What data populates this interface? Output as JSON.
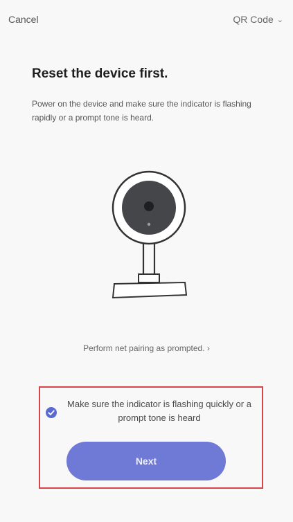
{
  "header": {
    "cancel_label": "Cancel",
    "mode_label": "QR Code",
    "mode_icon": "chevron-down-icon"
  },
  "main": {
    "title": "Reset the device first.",
    "description": "Power on the device and make sure the indicator is flashing rapidly or a prompt tone is heard.",
    "illustration": "camera-icon",
    "prompt_link": "Perform net pairing as prompted. ›"
  },
  "confirm": {
    "checked": true,
    "check_label": "Make sure the indicator is flashing quickly or a prompt tone is heard",
    "next_label": "Next"
  },
  "colors": {
    "accent": "#6f79d6",
    "highlight_border": "#d8434a",
    "background": "#f8f8f9"
  }
}
